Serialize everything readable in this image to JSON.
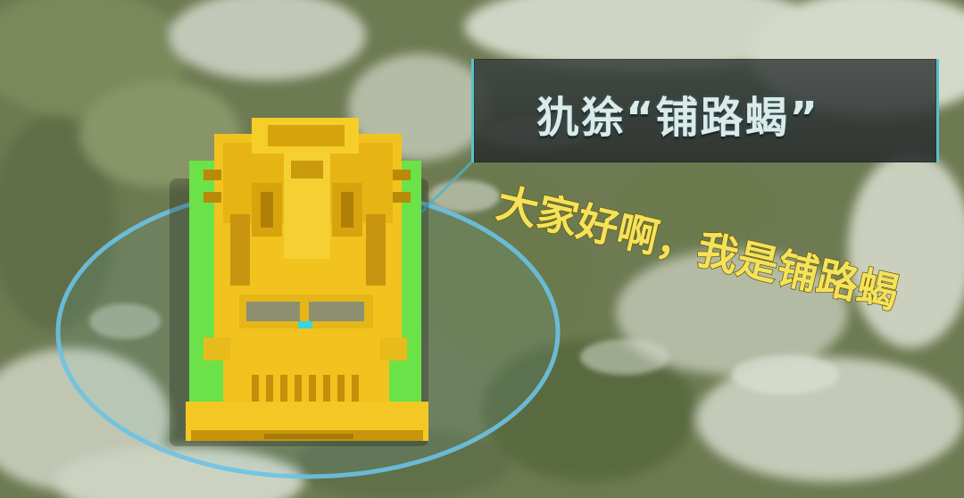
{
  "unit": {
    "name": "犰狳“铺路蝎”",
    "name_icon": "unit-nameplate"
  },
  "caption": {
    "text": "大家好啊，我是铺路蝎",
    "color": "#f4e35a"
  },
  "selection": {
    "ring_color": "#6cc3e6"
  },
  "vehicle": {
    "body_color": "#f2c21e",
    "accent_color": "#66e045",
    "icon": "armored-vehicle-icon"
  }
}
